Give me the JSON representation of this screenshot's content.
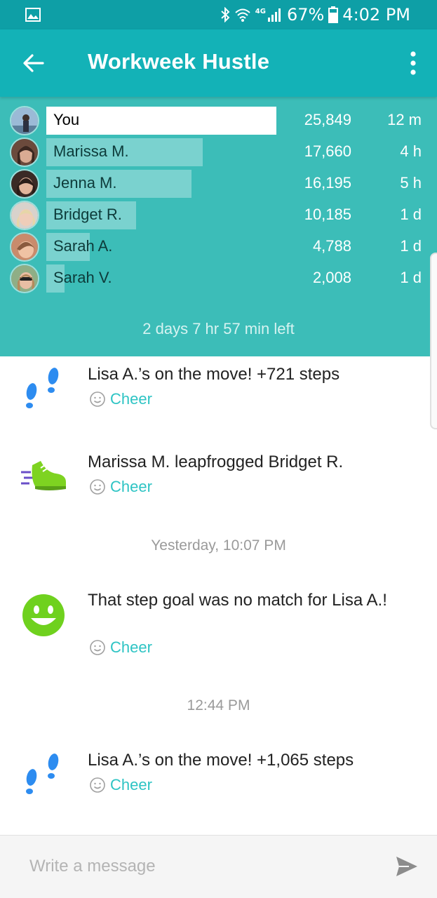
{
  "status_bar": {
    "network": "4G",
    "battery": "67%",
    "time": "4:02 PM"
  },
  "app_bar": {
    "title": "Workweek Hustle",
    "back_icon": "arrow-left-icon",
    "menu_icon": "more-vert-icon"
  },
  "leaderboard": {
    "rows": [
      {
        "name": "You",
        "steps": "25,849",
        "time": "12 m",
        "bar_fraction": 1.0
      },
      {
        "name": "Marissa M.",
        "steps": "17,660",
        "time": "4 h",
        "bar_fraction": 0.68
      },
      {
        "name": "Jenna M.",
        "steps": "16,195",
        "time": "5 h",
        "bar_fraction": 0.63
      },
      {
        "name": "Bridget R.",
        "steps": "10,185",
        "time": "1 d",
        "bar_fraction": 0.39
      },
      {
        "name": "Sarah A.",
        "steps": "4,788",
        "time": "1 d",
        "bar_fraction": 0.19
      },
      {
        "name": "Sarah V.",
        "steps": "2,008",
        "time": "1 d",
        "bar_fraction": 0.08
      }
    ],
    "time_left": "2 days 7 hr 57 min left"
  },
  "feed": {
    "items": [
      {
        "icon": "footprints-icon",
        "text": "Lisa A.’s on the move! +721 steps",
        "cheer": "Cheer"
      },
      {
        "icon": "sneaker-icon",
        "text": "Marissa M. leapfrogged Bridget R.",
        "cheer": "Cheer"
      },
      {
        "icon": "smiley-icon",
        "text": "That step goal was no match for Lisa A.!",
        "cheer": "Cheer"
      },
      {
        "icon": "footprints-icon",
        "text": "Lisa A.’s on the move! +1,065 steps",
        "cheer": "Cheer"
      }
    ],
    "timestamps": [
      "Yesterday, 10:07 PM",
      "12:44 PM"
    ]
  },
  "message_bar": {
    "placeholder": "Write a message",
    "send_icon": "send-icon"
  },
  "colors": {
    "status_bar": "#0e9fa6",
    "app_bar": "#13b2b7",
    "leaderboard": "#3cbdb8",
    "accent": "#2ec4c4"
  }
}
